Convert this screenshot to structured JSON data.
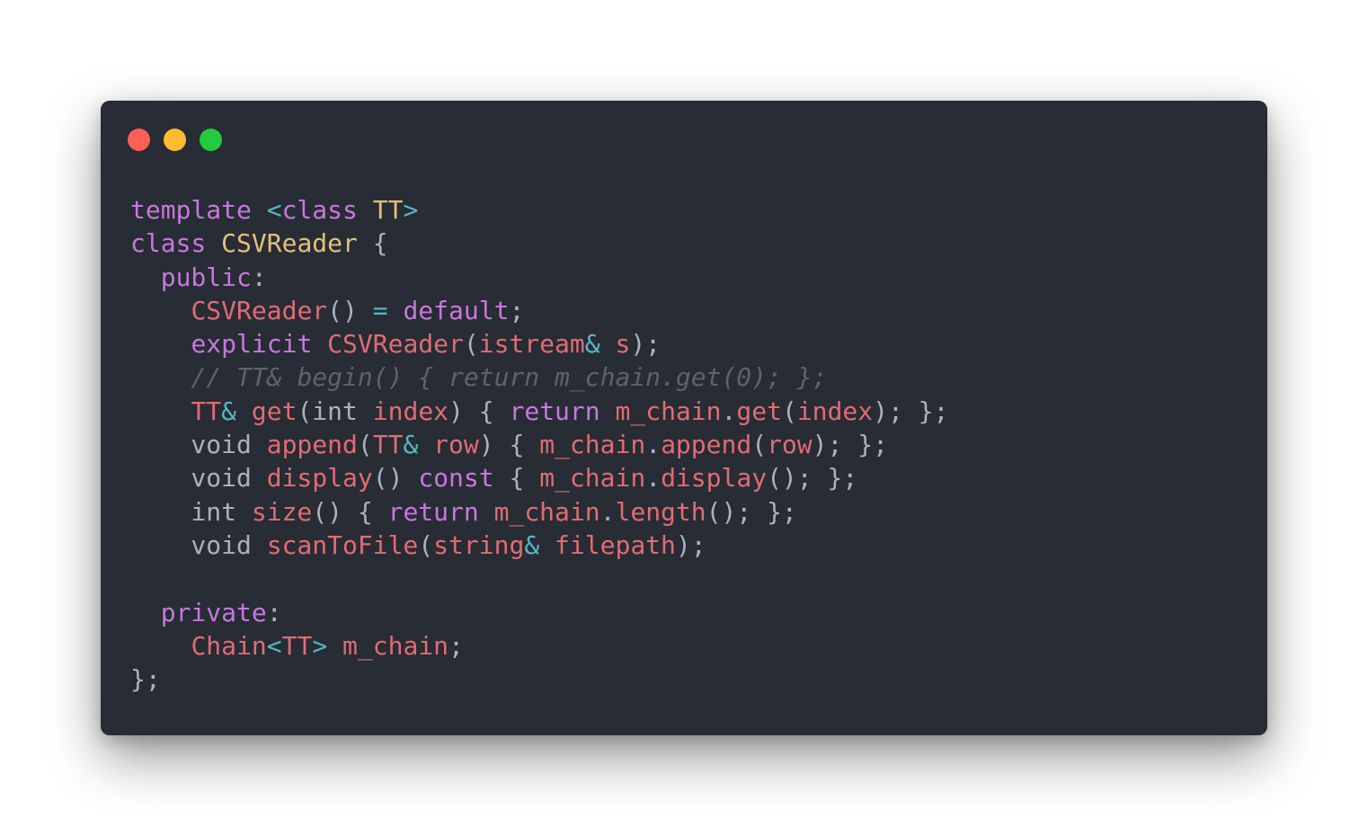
{
  "window": {
    "background": "#282c34",
    "traffic_lights": [
      {
        "name": "close",
        "color": "#ff5f56"
      },
      {
        "name": "minimize",
        "color": "#ffbd2e"
      },
      {
        "name": "zoom",
        "color": "#27c93f"
      }
    ]
  },
  "colors": {
    "kw": "#c678dd",
    "ty": "#e5c07b",
    "fn": "#e06c75",
    "op": "#56b6c2",
    "pl": "#abb2bf",
    "cm": "#5c6370"
  },
  "code": {
    "language": "C++",
    "lines": [
      [
        [
          "kw",
          "template"
        ],
        [
          "pl",
          " "
        ],
        [
          "op",
          "<"
        ],
        [
          "kw",
          "class"
        ],
        [
          "pl",
          " "
        ],
        [
          "ty",
          "TT"
        ],
        [
          "op",
          ">"
        ]
      ],
      [
        [
          "kw",
          "class"
        ],
        [
          "pl",
          " "
        ],
        [
          "ty",
          "CSVReader"
        ],
        [
          "pl",
          " {"
        ]
      ],
      [
        [
          "pl",
          "  "
        ],
        [
          "kw",
          "public"
        ],
        [
          "pl",
          ":"
        ]
      ],
      [
        [
          "pl",
          "    "
        ],
        [
          "fn",
          "CSVReader"
        ],
        [
          "pl",
          "() "
        ],
        [
          "op",
          "="
        ],
        [
          "pl",
          " "
        ],
        [
          "kw",
          "default"
        ],
        [
          "pl",
          ";"
        ]
      ],
      [
        [
          "pl",
          "    "
        ],
        [
          "kw",
          "explicit"
        ],
        [
          "pl",
          " "
        ],
        [
          "fn",
          "CSVReader"
        ],
        [
          "pl",
          "("
        ],
        [
          "fn",
          "istream"
        ],
        [
          "op",
          "&"
        ],
        [
          "pl",
          " "
        ],
        [
          "fn",
          "s"
        ],
        [
          "pl",
          ");"
        ]
      ],
      [
        [
          "pl",
          "    "
        ],
        [
          "cm",
          "// TT& begin() { return m_chain.get(0); };"
        ]
      ],
      [
        [
          "pl",
          "    "
        ],
        [
          "fn",
          "TT"
        ],
        [
          "op",
          "&"
        ],
        [
          "pl",
          " "
        ],
        [
          "fn",
          "get"
        ],
        [
          "pl",
          "(int "
        ],
        [
          "fn",
          "index"
        ],
        [
          "pl",
          ") { "
        ],
        [
          "kw",
          "return"
        ],
        [
          "pl",
          " "
        ],
        [
          "fn",
          "m_chain"
        ],
        [
          "pl",
          "."
        ],
        [
          "fn",
          "get"
        ],
        [
          "pl",
          "("
        ],
        [
          "fn",
          "index"
        ],
        [
          "pl",
          "); };"
        ]
      ],
      [
        [
          "pl",
          "    void "
        ],
        [
          "fn",
          "append"
        ],
        [
          "pl",
          "("
        ],
        [
          "fn",
          "TT"
        ],
        [
          "op",
          "&"
        ],
        [
          "pl",
          " "
        ],
        [
          "fn",
          "row"
        ],
        [
          "pl",
          ") { "
        ],
        [
          "fn",
          "m_chain"
        ],
        [
          "pl",
          "."
        ],
        [
          "fn",
          "append"
        ],
        [
          "pl",
          "("
        ],
        [
          "fn",
          "row"
        ],
        [
          "pl",
          "); };"
        ]
      ],
      [
        [
          "pl",
          "    void "
        ],
        [
          "fn",
          "display"
        ],
        [
          "pl",
          "() "
        ],
        [
          "kw",
          "const"
        ],
        [
          "pl",
          " { "
        ],
        [
          "fn",
          "m_chain"
        ],
        [
          "pl",
          "."
        ],
        [
          "fn",
          "display"
        ],
        [
          "pl",
          "(); };"
        ]
      ],
      [
        [
          "pl",
          "    int "
        ],
        [
          "fn",
          "size"
        ],
        [
          "pl",
          "() { "
        ],
        [
          "kw",
          "return"
        ],
        [
          "pl",
          " "
        ],
        [
          "fn",
          "m_chain"
        ],
        [
          "pl",
          "."
        ],
        [
          "fn",
          "length"
        ],
        [
          "pl",
          "(); };"
        ]
      ],
      [
        [
          "pl",
          "    void "
        ],
        [
          "fn",
          "scanToFile"
        ],
        [
          "pl",
          "("
        ],
        [
          "fn",
          "string"
        ],
        [
          "op",
          "&"
        ],
        [
          "pl",
          " "
        ],
        [
          "fn",
          "filepath"
        ],
        [
          "pl",
          ");"
        ]
      ],
      [],
      [
        [
          "pl",
          "  "
        ],
        [
          "kw",
          "private"
        ],
        [
          "pl",
          ":"
        ]
      ],
      [
        [
          "pl",
          "    "
        ],
        [
          "fn",
          "Chain"
        ],
        [
          "op",
          "<"
        ],
        [
          "fn",
          "TT"
        ],
        [
          "op",
          ">"
        ],
        [
          "pl",
          " "
        ],
        [
          "fn",
          "m_chain"
        ],
        [
          "pl",
          ";"
        ]
      ],
      [
        [
          "pl",
          "};"
        ]
      ]
    ]
  }
}
